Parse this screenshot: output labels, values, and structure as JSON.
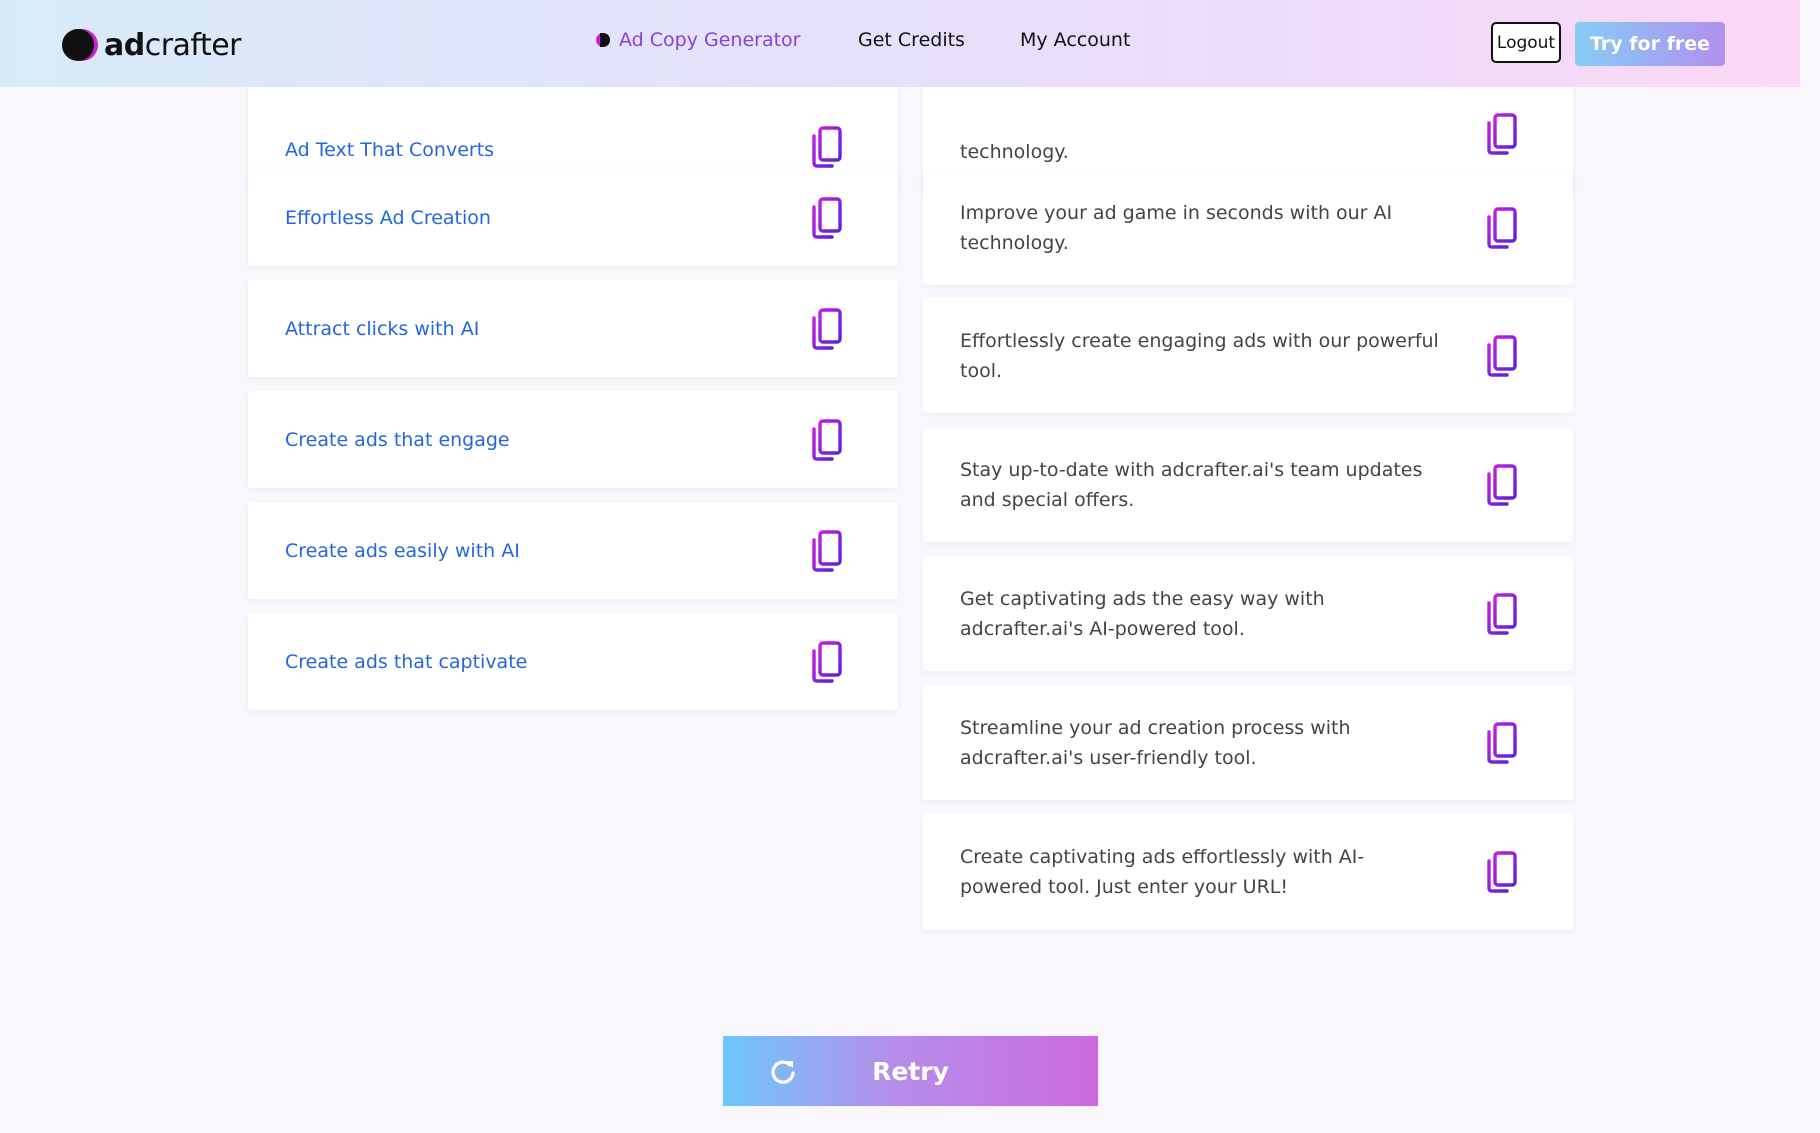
{
  "header": {
    "logo": {
      "bold": "ad",
      "rest": "crafter"
    },
    "nav": {
      "generator": "Ad Copy Generator",
      "credits": "Get Credits",
      "account": "My Account"
    },
    "logout_label": "Logout",
    "try_label": "Try for free"
  },
  "headlines": [
    "Ad Text That Converts",
    "Effortless Ad Creation",
    "Attract clicks with AI",
    "Create ads that engage",
    "Create ads easily with AI",
    "Create ads that captivate"
  ],
  "descriptions": [
    "technology.",
    "Improve your ad game in seconds with our AI technology.",
    "Effortlessly create engaging ads with our powerful tool.",
    "Stay up-to-date with adcrafter.ai's team updates and special offers.",
    "Get captivating ads the easy way with adcrafter.ai's AI-powered tool.",
    "Streamline your ad creation process with adcrafter.ai's user-friendly tool.",
    "Create captivating ads effortlessly with AI-powered tool. Just enter your URL!"
  ],
  "retry_label": "Retry",
  "colors": {
    "accent_purple": "#8a3fe0",
    "headline_blue": "#2466dd",
    "copy_icon_purple": "#7a1fe0"
  }
}
